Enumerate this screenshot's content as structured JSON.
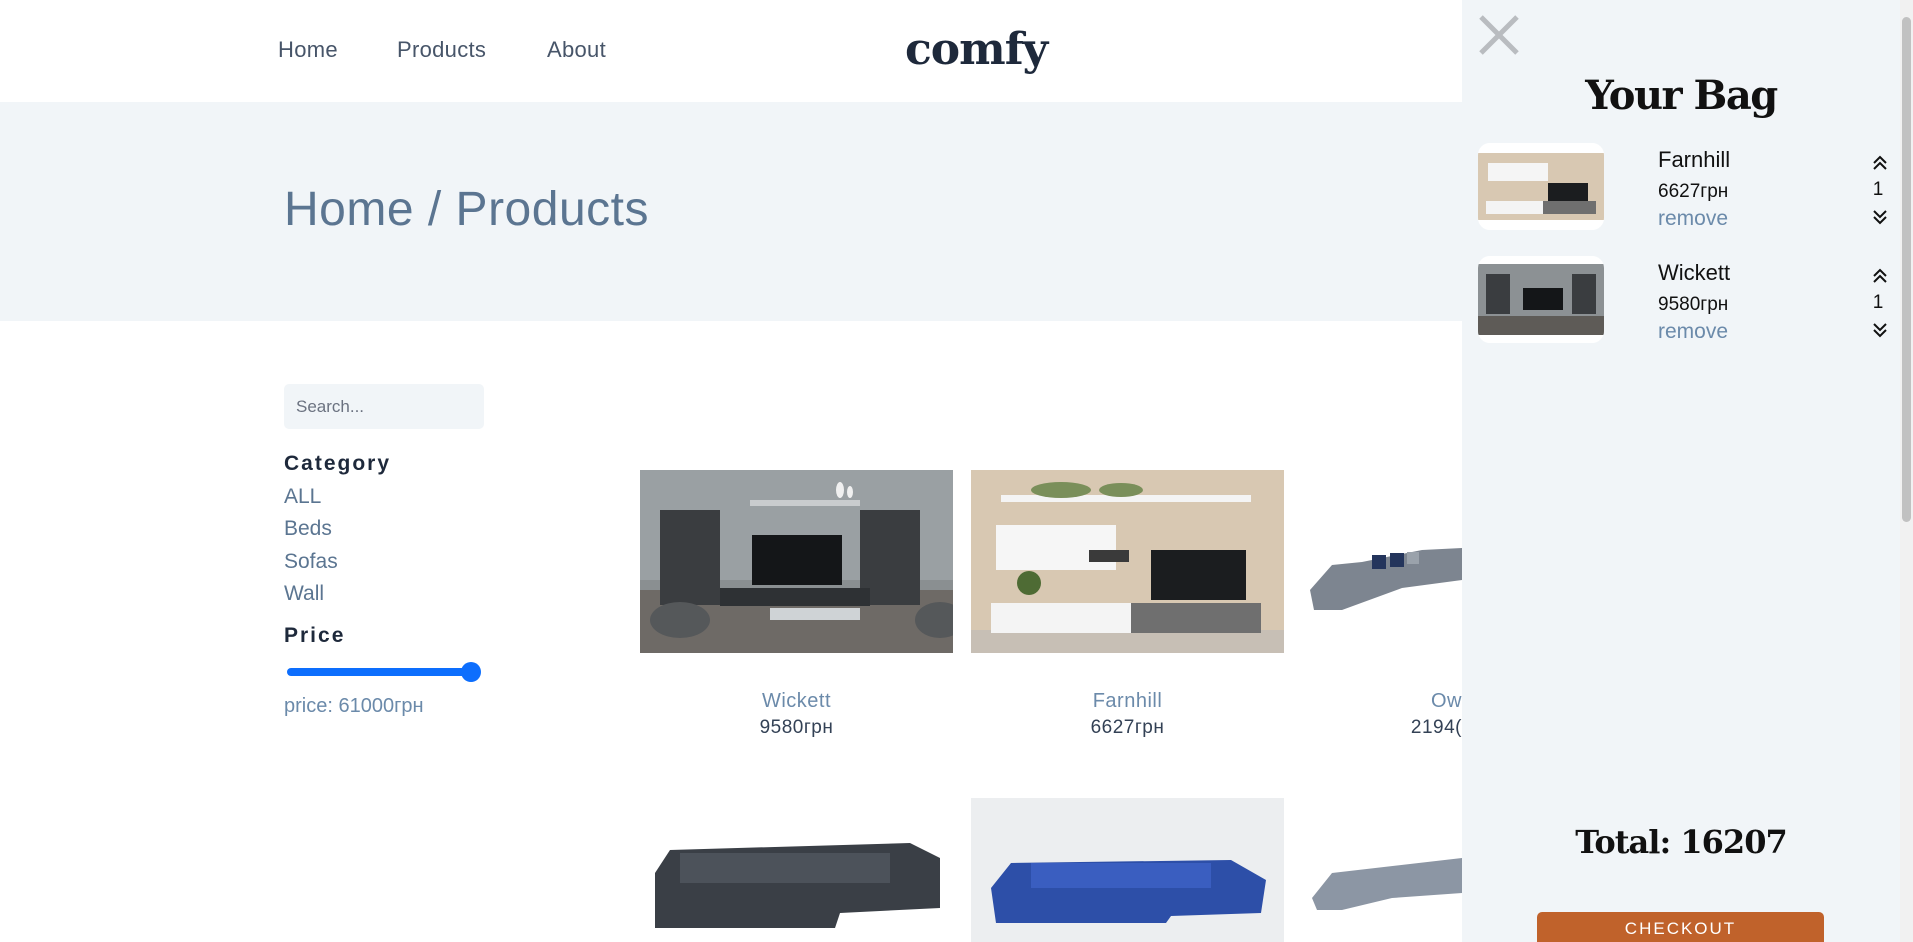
{
  "nav": {
    "links": [
      "Home",
      "Products",
      "About"
    ],
    "logo": "comfy"
  },
  "hero": {
    "title": "Home / Products"
  },
  "filters": {
    "search_placeholder": "Search...",
    "category_heading": "Category",
    "categories": [
      "ALL",
      "Beds",
      "Sofas",
      "Wall"
    ],
    "price_heading": "Price",
    "price_text": "price: 61000грн",
    "slider_value_fraction": 1.0
  },
  "products": [
    {
      "name": "Wickett",
      "price": "9580грн"
    },
    {
      "name": "Farnhill",
      "price": "6627грн"
    },
    {
      "name": "Ow",
      "price": "2194("
    }
  ],
  "cart": {
    "title": "Your Bag",
    "items": [
      {
        "name": "Farnhill",
        "price": "6627грн",
        "qty": "1",
        "remove": "remove"
      },
      {
        "name": "Wickett",
        "price": "9580грн",
        "qty": "1",
        "remove": "remove"
      }
    ],
    "total": "Total: 16207",
    "checkout": "CHECKOUT"
  },
  "colors": {
    "accent": "#0d6efd",
    "checkout": "#c0622b",
    "muted_text": "#6b8aaa",
    "hero_bg": "#f1f5f8"
  }
}
